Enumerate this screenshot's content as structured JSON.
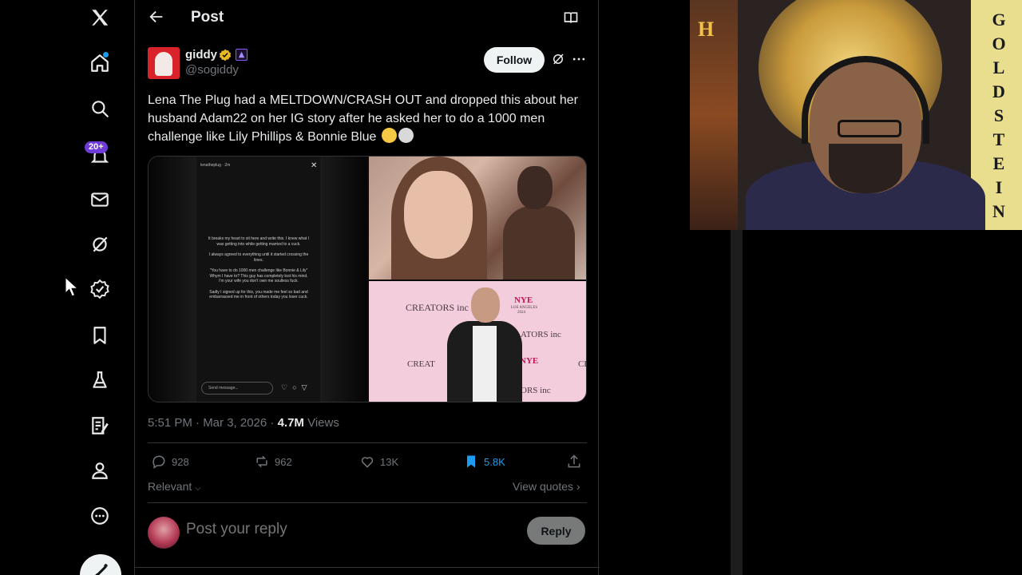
{
  "nav": {
    "badge": "20+",
    "items": [
      "x-logo-icon",
      "home-icon",
      "search-icon",
      "notifications-icon",
      "messages-icon",
      "grok-icon",
      "premium-icon",
      "bookmarks-icon",
      "labs-icon",
      "articles-icon",
      "profile-icon",
      "more-icon"
    ]
  },
  "header": {
    "title": "Post"
  },
  "post": {
    "display_name": "giddy",
    "handle": "@sogiddy",
    "follow_label": "Follow",
    "text": "Lena The Plug had a MELTDOWN/CRASH OUT and dropped this about her husband Adam22 on her IG story after he asked her to do a 1000 men challenge like Lily Phillips & Bonnie Blue",
    "timestamp": "5:51 PM · Mar 3, 2026 · ",
    "views_count": "4.7M",
    "views_label": " Views",
    "replies": "928",
    "reposts": "962",
    "likes": "13K",
    "bookmarks": "5.8K"
  },
  "story": {
    "user": "lenatheplug",
    "time": "2m",
    "paragraphs": [
      "It breaks my heart to sit here and write this. I knew what I was getting into while getting married to a cuck.",
      "I always agreed to everything until it started crossing the lines.",
      "\"You have to do 1000 men challenge like Bonnie & Lily\" Whym I have to? This guy has completely lost his mind. I'm your wife you don't own me soulless fuck.",
      "Sadly I signed up for this, you made me feel so bad and embarrassed me in front of others today you loser cuck."
    ],
    "send_placeholder": "Send message..."
  },
  "photo2": {
    "wall": [
      "CREATORS inc",
      "NYE",
      "LOS ANGELES",
      "2024",
      "ATORS inc",
      "CREAT",
      "NYE",
      "ORS inc",
      "CR"
    ]
  },
  "thread": {
    "sort_label": "Relevant",
    "view_quotes": "View quotes",
    "reply_placeholder": "Post your reply",
    "reply_button": "Reply"
  },
  "webcam": {
    "banner_letters": [
      "G",
      "O",
      "L",
      "D",
      "S",
      "T",
      "E",
      "I",
      "N"
    ],
    "left_letter": "H"
  },
  "colors": {
    "accent": "#1d9bf0",
    "badge": "#6e3ad8",
    "background": "#000000"
  }
}
